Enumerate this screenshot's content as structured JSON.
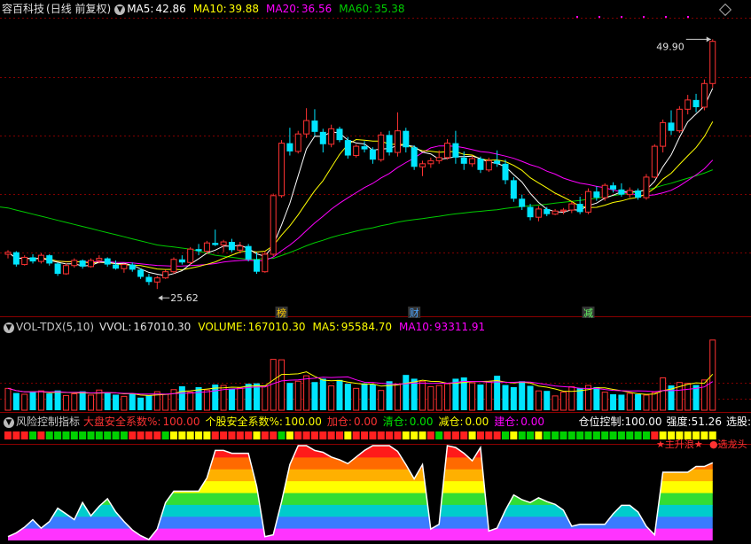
{
  "main": {
    "title": "容百科技",
    "period": "(日线 前复权)",
    "ma5_label": "MA5:",
    "ma5_value": "42.86",
    "ma10_label": "MA10:",
    "ma10_value": "39.88",
    "ma20_label": "MA20:",
    "ma20_value": "36.56",
    "ma60_label": "MA60:",
    "ma60_value": "35.38",
    "high_marker": "49.90",
    "low_marker": "25.62",
    "event_marks": [
      "榜",
      "财",
      "减"
    ]
  },
  "volume": {
    "title": "VOL-TDX(5,10)",
    "vvol_label": "VVOL:",
    "vvol_value": "167010.30",
    "volume_label": "VOLUME:",
    "volume_value": "167010.30",
    "ma5_label": "MA5:",
    "ma5_value": "95584.70",
    "ma10_label": "MA10:",
    "ma10_value": "93311.91"
  },
  "risk": {
    "title": "风险控制指标",
    "big_label": "大盘安全系数%:",
    "big_value": "100.00",
    "stock_label": "个股安全系数%:",
    "stock_value": "100.00",
    "add_label": "加仓:",
    "add_value": "0.00",
    "clear_label": "清仓:",
    "clear_value": "0.00",
    "reduce_label": "减仓:",
    "reduce_value": "0.00",
    "build_label": "建仓:",
    "build_value": "0.00",
    "pos_label": "仓位控制:",
    "pos_value": "100.00",
    "strength_label": "强度:",
    "strength_value": "51.26",
    "select_label": "选股:",
    "signal_text": "★主升浪★",
    "dragon_text": "●选龙头"
  },
  "colors": {
    "up": "#ff3232",
    "down": "#00e5ff",
    "ma5": "#ffffff",
    "ma10": "#ffff00",
    "ma20": "#ff00ff",
    "ma60": "#00cc00",
    "grid": "#800000"
  },
  "chart_data": [
    {
      "type": "candlestick",
      "title": "容百科技 (日线 前复权)",
      "ylim": [
        24,
        52
      ],
      "moving_averages": {
        "MA5": 42.86,
        "MA10": 39.88,
        "MA20": 36.56,
        "MA60": 35.38
      },
      "annotations": [
        {
          "text": "49.90",
          "kind": "high"
        },
        {
          "text": "25.62",
          "kind": "low"
        }
      ],
      "candles": [
        [
          29.0,
          29.4,
          28.6,
          29.2
        ],
        [
          29.2,
          29.3,
          27.8,
          28.0
        ],
        [
          28.0,
          28.9,
          27.9,
          28.7
        ],
        [
          28.7,
          29.0,
          28.1,
          28.3
        ],
        [
          28.3,
          29.1,
          28.1,
          28.9
        ],
        [
          28.9,
          29.0,
          27.9,
          28.1
        ],
        [
          28.1,
          28.2,
          26.9,
          27.1
        ],
        [
          27.1,
          28.1,
          27.0,
          27.9
        ],
        [
          27.9,
          28.6,
          27.7,
          28.4
        ],
        [
          28.4,
          28.5,
          27.6,
          27.8
        ],
        [
          27.8,
          28.6,
          27.7,
          28.4
        ],
        [
          28.4,
          28.9,
          28.1,
          28.6
        ],
        [
          28.6,
          28.7,
          27.8,
          28.0
        ],
        [
          28.0,
          28.4,
          27.5,
          27.6
        ],
        [
          27.6,
          28.1,
          27.2,
          28.0
        ],
        [
          28.0,
          28.2,
          27.3,
          27.5
        ],
        [
          27.5,
          27.6,
          26.6,
          26.8
        ],
        [
          26.8,
          27.1,
          26.0,
          26.3
        ],
        [
          26.3,
          26.9,
          25.62,
          26.7
        ],
        [
          26.7,
          27.5,
          26.6,
          27.3
        ],
        [
          27.3,
          28.7,
          27.1,
          28.5
        ],
        [
          28.5,
          28.9,
          28.0,
          28.2
        ],
        [
          28.2,
          29.7,
          28.0,
          29.5
        ],
        [
          29.5,
          30.0,
          28.9,
          29.3
        ],
        [
          29.3,
          30.3,
          29.0,
          30.1
        ],
        [
          30.1,
          31.4,
          29.8,
          29.9
        ],
        [
          29.9,
          30.4,
          29.2,
          30.2
        ],
        [
          30.2,
          30.5,
          29.2,
          29.4
        ],
        [
          29.4,
          30.2,
          29.1,
          29.8
        ],
        [
          29.8,
          30.0,
          28.3,
          28.5
        ],
        [
          28.5,
          29.2,
          27.1,
          27.3
        ],
        [
          27.3,
          29.3,
          27.2,
          29.0
        ],
        [
          29.0,
          34.9,
          28.8,
          34.7
        ],
        [
          34.7,
          40.1,
          34.5,
          39.8
        ],
        [
          39.8,
          41.3,
          38.6,
          39.0
        ],
        [
          39.0,
          41.0,
          38.8,
          40.7
        ],
        [
          40.7,
          43.2,
          40.3,
          42.0
        ],
        [
          42.0,
          43.1,
          40.5,
          40.9
        ],
        [
          40.9,
          41.2,
          38.9,
          39.7
        ],
        [
          39.7,
          41.6,
          39.4,
          41.2
        ],
        [
          41.2,
          41.4,
          39.9,
          40.1
        ],
        [
          40.1,
          40.4,
          38.3,
          38.6
        ],
        [
          38.6,
          39.7,
          38.4,
          39.5
        ],
        [
          39.5,
          40.0,
          38.9,
          39.2
        ],
        [
          39.2,
          39.4,
          37.8,
          38.2
        ],
        [
          38.2,
          40.9,
          38.0,
          40.6
        ],
        [
          40.6,
          41.0,
          38.6,
          38.9
        ],
        [
          38.9,
          42.8,
          38.5,
          41.0
        ],
        [
          41.0,
          41.3,
          38.9,
          39.4
        ],
        [
          39.4,
          39.6,
          37.2,
          37.5
        ],
        [
          37.5,
          38.1,
          36.6,
          37.8
        ],
        [
          37.8,
          38.4,
          37.4,
          38.1
        ],
        [
          38.1,
          39.1,
          37.8,
          38.4
        ],
        [
          38.4,
          40.2,
          38.2,
          39.8
        ],
        [
          39.8,
          41.0,
          37.8,
          38.4
        ],
        [
          38.4,
          39.0,
          37.2,
          37.8
        ],
        [
          37.8,
          38.6,
          37.5,
          38.3
        ],
        [
          38.3,
          38.5,
          36.9,
          37.2
        ],
        [
          37.2,
          38.4,
          37.0,
          38.1
        ],
        [
          38.1,
          39.1,
          37.5,
          37.8
        ],
        [
          37.8,
          38.2,
          35.8,
          36.2
        ],
        [
          36.2,
          36.5,
          34.1,
          34.4
        ],
        [
          34.4,
          34.8,
          33.3,
          33.6
        ],
        [
          33.6,
          33.9,
          32.3,
          32.6
        ],
        [
          32.6,
          33.7,
          32.2,
          33.4
        ],
        [
          33.4,
          33.6,
          32.7,
          32.9
        ],
        [
          32.9,
          33.4,
          32.8,
          33.2
        ],
        [
          33.2,
          33.5,
          32.9,
          33.3
        ],
        [
          33.3,
          34.1,
          33.0,
          33.9
        ],
        [
          33.9,
          34.6,
          32.9,
          33.1
        ],
        [
          33.1,
          35.4,
          32.9,
          35.1
        ],
        [
          35.1,
          35.6,
          34.2,
          34.5
        ],
        [
          34.5,
          35.9,
          34.2,
          35.7
        ],
        [
          35.7,
          36.0,
          35.0,
          35.3
        ],
        [
          35.3,
          35.9,
          34.6,
          34.8
        ],
        [
          34.8,
          35.5,
          34.5,
          35.2
        ],
        [
          35.2,
          35.4,
          34.3,
          34.5
        ],
        [
          34.5,
          36.8,
          34.3,
          36.5
        ],
        [
          36.5,
          39.7,
          36.4,
          39.5
        ],
        [
          39.5,
          42.1,
          38.9,
          41.8
        ],
        [
          41.8,
          43.0,
          40.6,
          41.0
        ],
        [
          41.0,
          43.4,
          40.8,
          43.1
        ],
        [
          43.1,
          44.5,
          42.6,
          44.0
        ],
        [
          44.0,
          44.6,
          42.8,
          43.3
        ],
        [
          43.3,
          46.0,
          43.0,
          45.6
        ],
        [
          45.6,
          49.9,
          45.2,
          49.7
        ]
      ]
    },
    {
      "type": "bar",
      "title": "VOL-TDX(5,10)",
      "series": [
        {
          "name": "VOLUME",
          "values": [
            52,
            41,
            38,
            44,
            46,
            40,
            47,
            35,
            39,
            45,
            36,
            48,
            41,
            37,
            33,
            39,
            30,
            36,
            44,
            38,
            49,
            57,
            43,
            55,
            48,
            61,
            59,
            51,
            53,
            63,
            64,
            58,
            121,
            120,
            65,
            69,
            82,
            67,
            75,
            58,
            72,
            63,
            52,
            64,
            61,
            47,
            69,
            61,
            84,
            75,
            68,
            56,
            59,
            63,
            75,
            78,
            65,
            61,
            67,
            82,
            60,
            55,
            69,
            58,
            46,
            46,
            34,
            43,
            56,
            53,
            59,
            55,
            43,
            38,
            37,
            40,
            38,
            36,
            42,
            77,
            59,
            66,
            64,
            60,
            72,
            167
          ]
        },
        {
          "name": "MA5",
          "values": [
            95584.7
          ]
        },
        {
          "name": "MA10",
          "values": [
            93311.91
          ]
        }
      ]
    },
    {
      "type": "area",
      "title": "风险控制指标",
      "ylim": [
        0,
        100
      ],
      "series": [
        {
          "name": "强度",
          "values": [
            4,
            8,
            14,
            22,
            13,
            20,
            34,
            28,
            22,
            40,
            26,
            36,
            44,
            30,
            20,
            11,
            5,
            1,
            12,
            40,
            52,
            52,
            52,
            52,
            66,
            95,
            95,
            92,
            92,
            92,
            57,
            4,
            6,
            41,
            80,
            100,
            100,
            95,
            93,
            88,
            85,
            81,
            88,
            95,
            100,
            100,
            100,
            94,
            80,
            65,
            80,
            12,
            17,
            100,
            98,
            92,
            84,
            98,
            10,
            13,
            32,
            48,
            43,
            40,
            45,
            41,
            38,
            32,
            15,
            17,
            17,
            17,
            17,
            28,
            37,
            37,
            30,
            15,
            6,
            72,
            72,
            72,
            72,
            78,
            78,
            82
          ]
        }
      ]
    }
  ]
}
